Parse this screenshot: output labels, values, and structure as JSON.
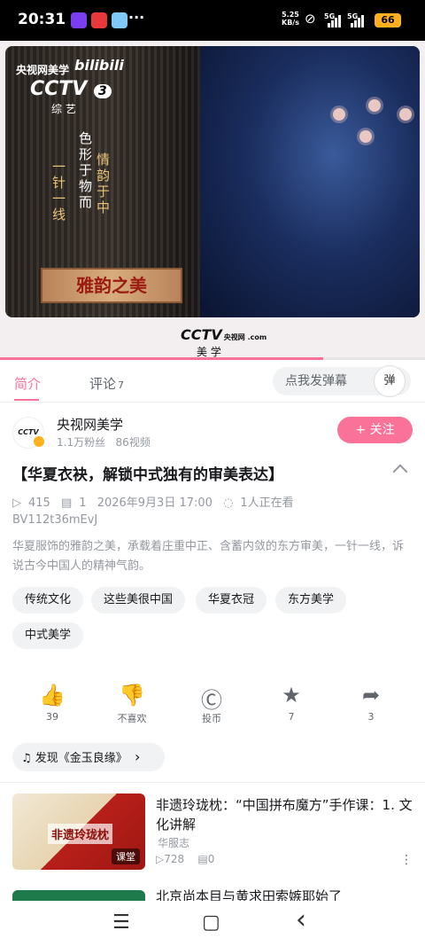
{
  "status_bar": {
    "time": "20:31",
    "more": "···",
    "net_speed_value": "5.25",
    "net_speed_unit": "KB/s",
    "sig1": "5G",
    "sig2": "5G",
    "battery": "66",
    "app_colors": [
      "#7b3ff2",
      "#e8383b",
      "#7fc8f8"
    ]
  },
  "video": {
    "logo_text": "央视网美学",
    "bili_text": "bilibili",
    "cctv_text": "CCTV",
    "cctv_num": "3",
    "cctv_sub": "综 艺",
    "vertical_1": "一针一线",
    "vertical_2": "色形于物而",
    "vertical_3": "情韵于中",
    "plaque": "雅韵之美",
    "foot_logo": "CCTV",
    "foot_logo_small": "央视网 .com",
    "foot_sub": "美 学",
    "progress": 0.76
  },
  "tabs": {
    "intro": "简介",
    "comments": "评论",
    "comments_count": "7",
    "danmaku_placeholder": "点我发弹幕",
    "danmaku_btn": "弹"
  },
  "uploader": {
    "avatar_text": "CCTV",
    "name": "央视网美学",
    "fans": "1.1万粉丝",
    "videos": "86视频",
    "follow": "+ 关注"
  },
  "video_info": {
    "title": "【华夏衣袂，解锁中式独有的审美表达】",
    "views": "415",
    "danmaku_count": "1",
    "date": "2026年9月3日 17:00",
    "watching": "1人正在看",
    "bvid": "BV112t36mEvJ",
    "description": "华夏服饰的雅韵之美，承载着庄重中正、含蓄内敛的东方审美，一针一线，诉说古今中国人的精神气韵。"
  },
  "tags": [
    "传统文化",
    "这些美很中国",
    "华夏衣冠",
    "东方美学",
    "中式美学"
  ],
  "actions": [
    {
      "icon": "like-icon",
      "glyph": "👍",
      "label": "39"
    },
    {
      "icon": "dislike-icon",
      "glyph": "👎",
      "label": "不喜欢"
    },
    {
      "icon": "coin-icon",
      "glyph": "Ⓒ",
      "label": "投币"
    },
    {
      "icon": "star-icon",
      "glyph": "★",
      "label": "7"
    },
    {
      "icon": "share-icon",
      "glyph": "➦",
      "label": "3"
    }
  ],
  "music": {
    "icon": "♫",
    "text": "发现《金玉良缘》",
    "chevron": "›"
  },
  "recommended": [
    {
      "thumb_text": "非遗玲珑枕",
      "badge": "课堂",
      "title": "非遗玲珑枕：“中国拼布魔方”手作课：1. 文化讲解",
      "author": "华服志",
      "views": "728",
      "danmaku": "0"
    }
  ],
  "recommended_next_title": "北京尚本目与黄求田索嫉耶始了",
  "navbar": {
    "menu": "☰",
    "home": "▢",
    "back": "‹"
  }
}
